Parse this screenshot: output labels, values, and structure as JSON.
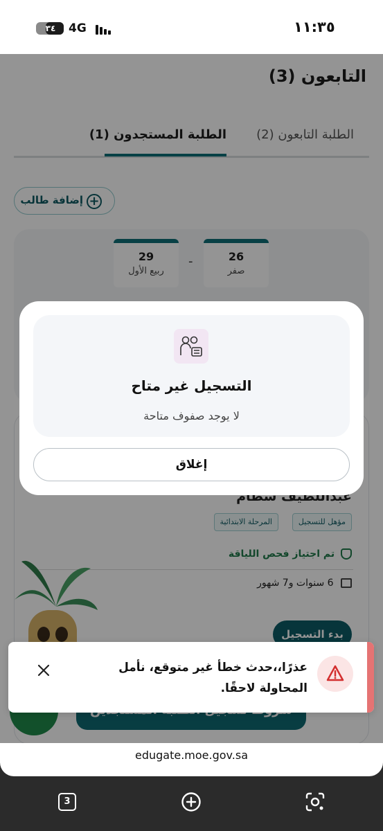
{
  "status_bar": {
    "time": "١١:٣٥",
    "battery": "٣٤",
    "battery_level": 0.34,
    "network": "4G"
  },
  "page": {
    "title": "التابعون (3)",
    "tabs": [
      {
        "label": "الطلبة التابعون (2)",
        "active": false
      },
      {
        "label": "الطلبة المستجدون (1)",
        "active": true
      }
    ],
    "add_student_label": "إضافة طالب",
    "dates": [
      {
        "day": "26",
        "month": "صفر"
      },
      {
        "day": "29",
        "month": "ربيع الأول"
      }
    ],
    "date_separator": "-",
    "student": {
      "name": "عبداللطيف سطام",
      "badges": [
        "مؤهل للتسجيل",
        "المرحلة الابتدائية"
      ],
      "fitness_status": "تم اجتياز فحص اللياقة",
      "age": "6 سنوات و7 شهور",
      "start_label": "بدء التسجيل"
    },
    "terms_label": "شروط تسجيل الطلبة المستجدين"
  },
  "modal": {
    "title": "التسجيل غير متاح",
    "message": "لا يوجد صفوف متاحة",
    "close_label": "إغلاق",
    "icon": "students-board-icon"
  },
  "toast": {
    "message": "عذرًا،،حدث خطأ غير متوقع، نأمل المحاولة لاحقًا.",
    "icon": "warning-icon",
    "accent": "#e57373"
  },
  "browser": {
    "url": "edugate.moe.gov.sa",
    "tab_count": "3"
  },
  "colors": {
    "primary": "#0e6f77",
    "success": "#1f7a4a",
    "error": "#e57373"
  }
}
